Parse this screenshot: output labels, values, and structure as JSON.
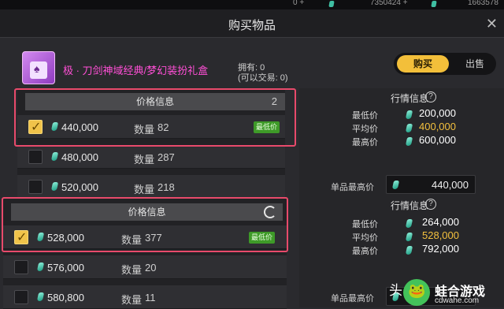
{
  "topbar": {
    "values": [
      "0 +",
      "7350424 +",
      "1663578"
    ]
  },
  "window": {
    "title": "购买物品",
    "close_glyph": "✕"
  },
  "item": {
    "name": "极 · 刀剑神域经典/梦幻装扮礼盒",
    "owned_line1": "拥有: 0",
    "owned_line2": "(可以交易: 0)"
  },
  "mode": {
    "buy": "购买",
    "sell": "出售"
  },
  "listing_a": {
    "header": "价格信息",
    "page": "2",
    "rows": [
      {
        "price": "440,000",
        "qty_label": "数量",
        "qty": "82",
        "badge": "最低价",
        "checked": true
      },
      {
        "price": "480,000",
        "qty_label": "数量",
        "qty": "287",
        "badge": "",
        "checked": false
      },
      {
        "price": "520,000",
        "qty_label": "数量",
        "qty": "218",
        "badge": "",
        "checked": false
      }
    ]
  },
  "listing_b": {
    "header": "价格信息",
    "rows": [
      {
        "price": "528,000",
        "qty_label": "数量",
        "qty": "377",
        "badge": "最低价",
        "checked": true
      },
      {
        "price": "576,000",
        "qty_label": "数量",
        "qty": "20",
        "badge": "",
        "checked": false
      },
      {
        "price": "580,800",
        "qty_label": "数量",
        "qty": "11",
        "badge": "",
        "checked": false
      }
    ]
  },
  "market_a": {
    "title": "行情信息",
    "help": "?",
    "rows": [
      {
        "label": "最低价",
        "value": "200,000",
        "color": "#ffffff"
      },
      {
        "label": "平均价",
        "value": "400,000",
        "color": "#f3c03e"
      },
      {
        "label": "最高价",
        "value": "600,000",
        "color": "#ffffff"
      }
    ],
    "unit_label": "单品最高价",
    "unit_value": "440,000"
  },
  "market_b": {
    "title": "行情信息",
    "help": "?",
    "rows": [
      {
        "label": "最低价",
        "value": "264,000",
        "color": "#ffffff"
      },
      {
        "label": "平均价",
        "value": "528,000",
        "color": "#f3c03e"
      },
      {
        "label": "最高价",
        "value": "792,000",
        "color": "#ffffff"
      }
    ],
    "unit_label": "单品最高价"
  },
  "partial_text": "头",
  "watermark": {
    "name": "蛙合游戏",
    "url": "cdwahe.com"
  },
  "colors": {
    "accent": "#f3bf3a",
    "highlight": "#e84a6b",
    "badge": "#3e9a28",
    "item_name": "#ff4fd6"
  }
}
